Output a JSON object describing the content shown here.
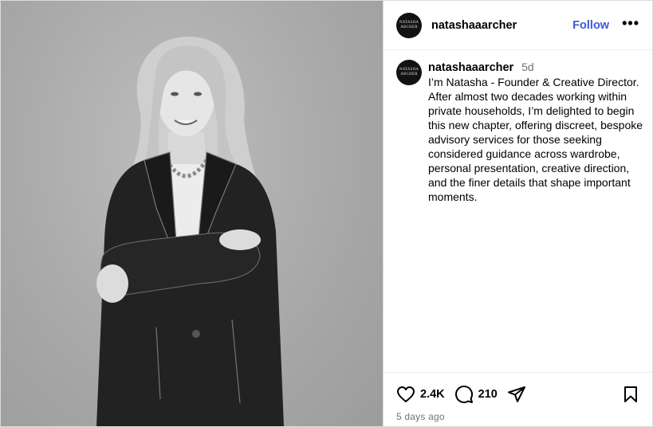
{
  "post": {
    "username": "natashaaarcher",
    "follow_label": "Follow",
    "more_label": "•••",
    "avatar_text_line1": "NATASHA",
    "avatar_text_line2": "ARCHER"
  },
  "caption": {
    "username": "natashaaarcher",
    "time": "5d",
    "text": "I’m Natasha - Founder & Creative Director.\nAfter almost two decades working within private households, I’m delighted to begin this new chapter, offering discreet, bespoke advisory services for those seeking considered guidance across wardrobe, personal presentation, creative direction, and the finer details that shape important moments."
  },
  "actions": {
    "likes": "2.4K",
    "comments": "210",
    "posted_ago": "5 days ago"
  },
  "icons": {
    "like": "heart-icon",
    "comment": "comment-icon",
    "share": "share-icon",
    "save": "bookmark-icon"
  }
}
